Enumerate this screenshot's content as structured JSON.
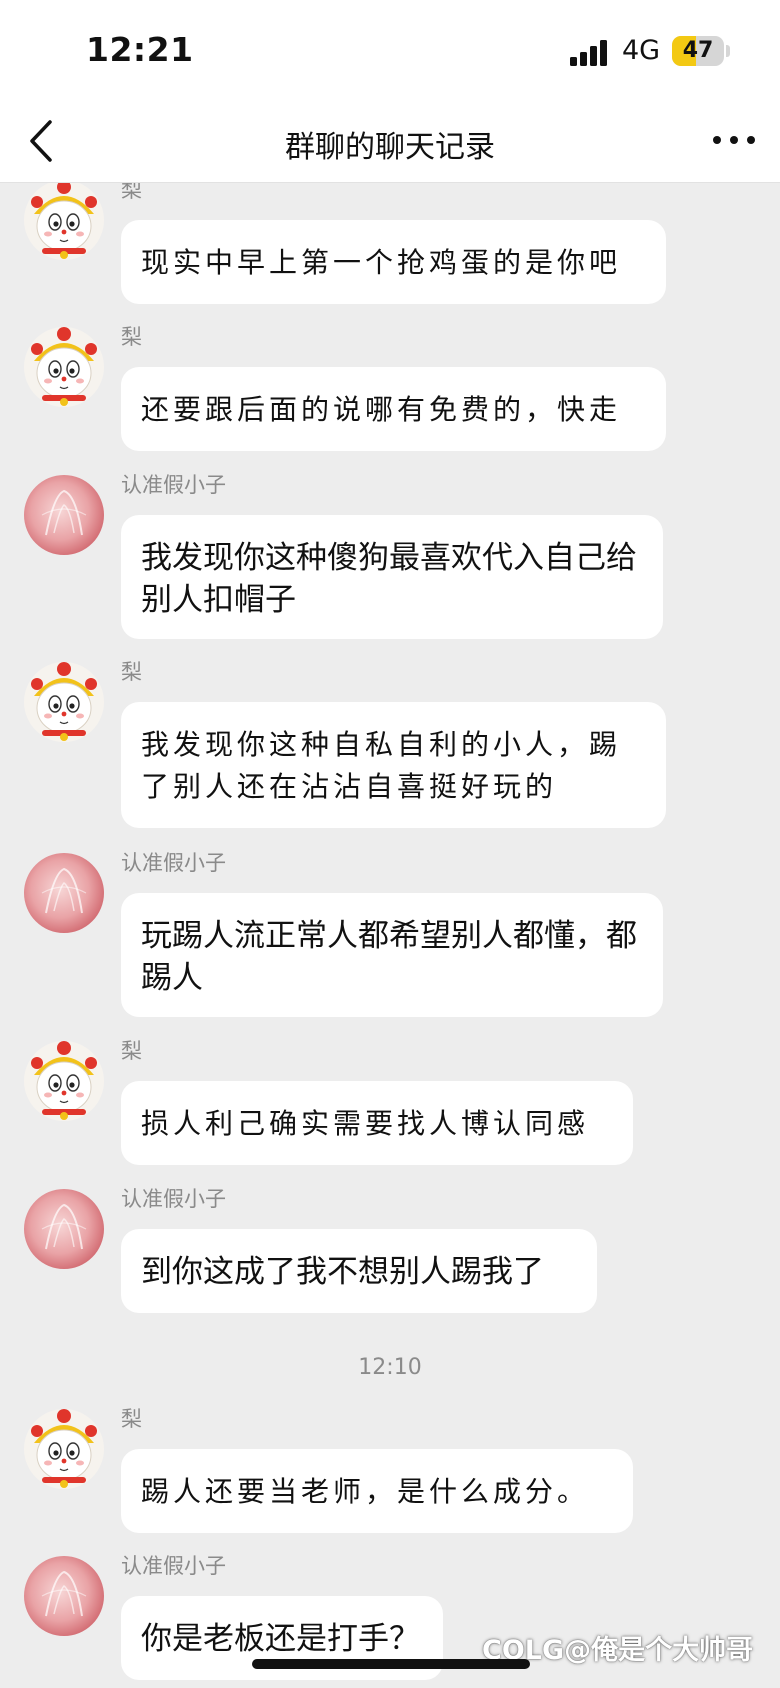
{
  "status_bar": {
    "time": "12:21",
    "network": "4G",
    "battery": "47",
    "battery_level": 0.47
  },
  "nav": {
    "title": "群聊的聊天记录",
    "back_icon": "chevron-left-icon",
    "more_icon": "more-horizontal-icon"
  },
  "messages": [
    {
      "sender": "梨",
      "text": "现实中早上第一个抢鸡蛋的是你吧"
    },
    {
      "sender": "梨",
      "text": "还要跟后面的说哪有免费的，快走"
    },
    {
      "sender": "认准假小子",
      "text": "我发现你这种傻狗最喜欢代入自己给别人扣帽子"
    },
    {
      "sender": "梨",
      "text": "我发现你这种自私自利的小人，踢了别人还在沾沾自喜挺好玩的"
    },
    {
      "sender": "认准假小子",
      "text": "玩踢人流正常人都希望别人都懂，都踢人"
    },
    {
      "sender": "梨",
      "text": "损人利己确实需要找人博认同感"
    },
    {
      "sender": "认准假小子",
      "text": "到你这成了我不想别人踢我了"
    },
    {
      "sender": "梨",
      "text": "踢人还要当老师，是什么成分。"
    },
    {
      "sender": "认准假小子",
      "text": "你是老板还是打手？"
    }
  ],
  "timestamp": "12:10",
  "watermark": "COLG@俺是个大帅哥",
  "colors": {
    "background": "#ededed",
    "bubble": "#ffffff",
    "battery": "#f3c913"
  }
}
